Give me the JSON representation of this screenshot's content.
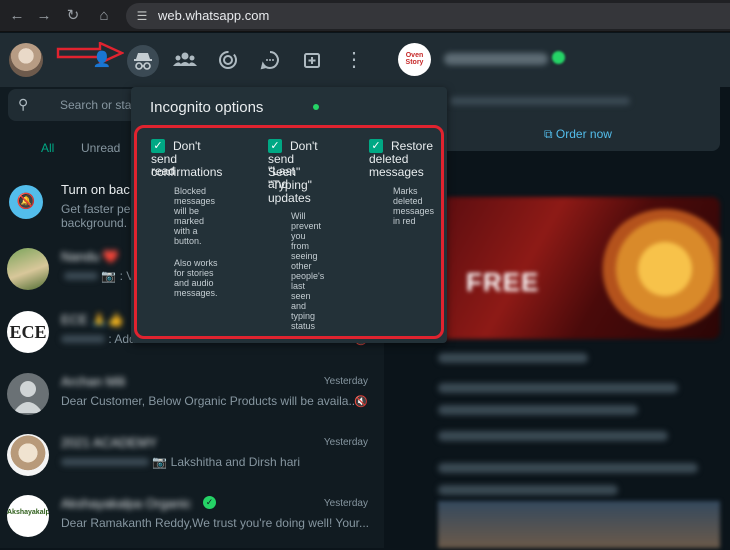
{
  "browser": {
    "url": "web.whatsapp.com",
    "icons": [
      "back-icon",
      "forward-icon",
      "reload-icon",
      "home-icon",
      "site-settings-icon"
    ]
  },
  "sidebar": {
    "header_icons": [
      "new-chat-icon",
      "incognito-icon",
      "communities-icon",
      "status-icon",
      "channels-icon",
      "new-group-icon",
      "menu-icon"
    ],
    "search_placeholder": "Search or sta",
    "filters": [
      "All",
      "Unread"
    ],
    "chats": [
      {
        "title": "Turn on bac",
        "sub": "Get faster per",
        "sub2": "background.",
        "time": "",
        "icon": "bell-off-icon"
      },
      {
        "title": "Nandu ❤️",
        "sub": ": Ve",
        "time": "",
        "icon": "camera-icon"
      },
      {
        "title": "ECE 🙏👍",
        "sub": ": Added",
        "time": "",
        "icon": "mute-icon"
      },
      {
        "title": "Archan Mili",
        "sub": "Dear Customer, Below Organic Products will be availa...",
        "time": "Yesterday",
        "icon": "mute-icon"
      },
      {
        "title": "2021 ACADEMY",
        "sub": "Lakshitha and Dirsh hari",
        "time": "Yesterday",
        "icon": "camera-icon"
      },
      {
        "title": "Akshayakalpa Organic",
        "sub": "Dear Ramakanth Reddy,We trust you're doing well! Your...",
        "time": "Yesterday",
        "icon": "verified-icon"
      }
    ]
  },
  "incognito": {
    "title": "Incognito options",
    "options": [
      {
        "label_lines": [
          "Don't",
          "send read",
          "confirmations"
        ],
        "desc_lines": [
          "Blocked",
          "messages",
          "will be",
          "marked",
          "with a",
          "button.",
          "",
          "Also works",
          "for stories",
          "and audio",
          "messages."
        ]
      },
      {
        "label_lines": [
          "Don't",
          "send \"Last",
          "Seen\" and",
          "\"Typing\"",
          "updates"
        ],
        "desc_lines": [
          "Will",
          "prevent",
          "you",
          "from",
          "seeing",
          "other",
          "people's",
          "last",
          "seen",
          "and",
          "typing",
          "status"
        ]
      },
      {
        "label_lines": [
          "Restore",
          "deleted",
          "messages"
        ],
        "desc_lines": [
          "Marks",
          "deleted",
          "messages",
          "in red"
        ]
      }
    ]
  },
  "conversation": {
    "store_logo_text": "Oven Story",
    "order_label": "Order now",
    "promo_text": "FREE"
  },
  "colors": {
    "accent": "#00a884",
    "highlight_border": "#e0232f",
    "arrow": "#e0232f",
    "link": "#53bdeb"
  }
}
